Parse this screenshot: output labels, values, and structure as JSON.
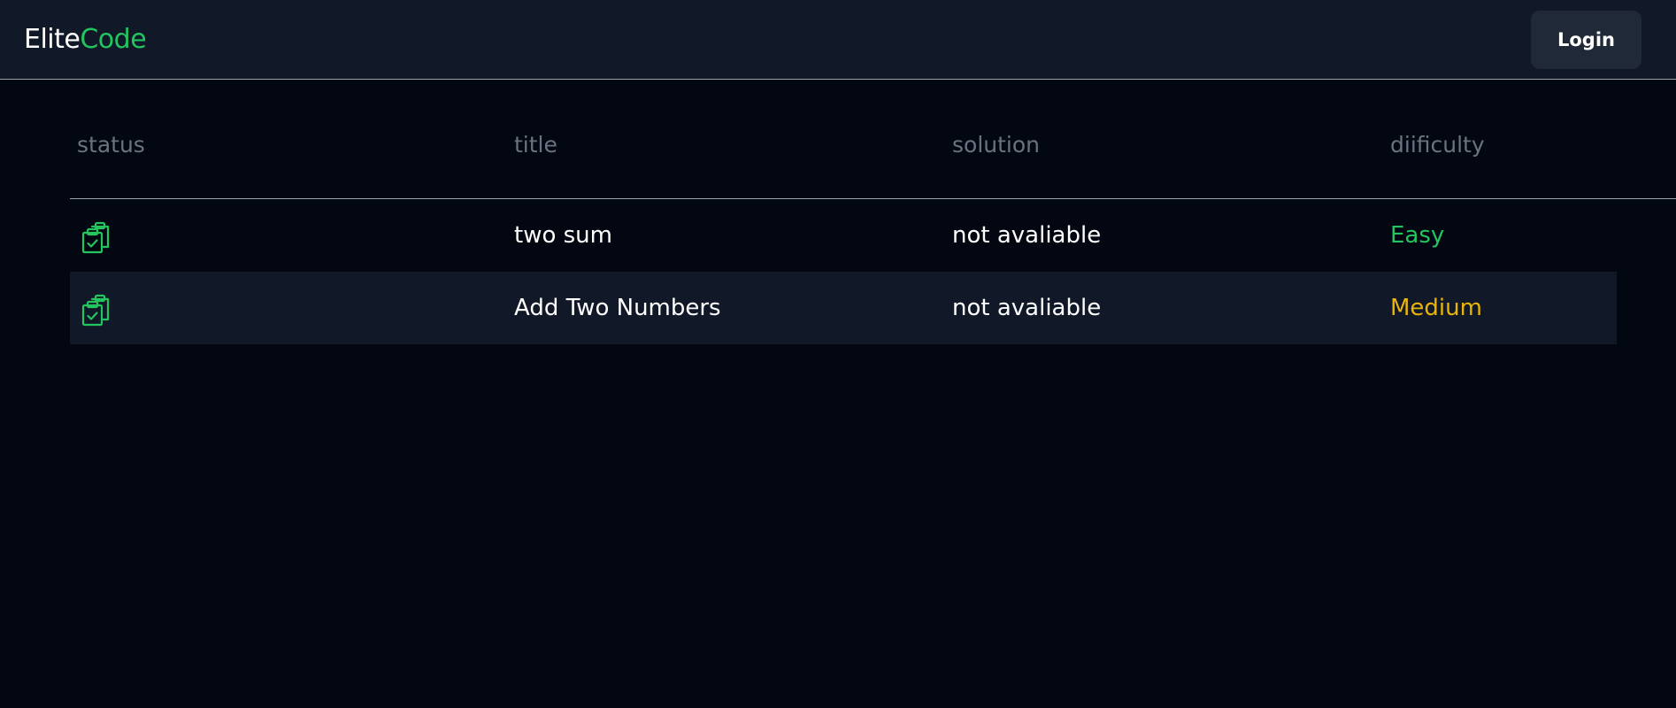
{
  "navbar": {
    "brand_part1": "Elite",
    "brand_part2": "Code",
    "login_label": "Login"
  },
  "colors": {
    "accent": "#22c55e",
    "easy": "#22c55e",
    "medium": "#eab308",
    "background": "#030712",
    "navbar_bg": "#111827"
  },
  "table": {
    "headers": [
      "status",
      "title",
      "solution",
      "diificulty"
    ],
    "rows": [
      {
        "status_icon": "clipboard-check-icon",
        "title": "two sum",
        "solution": "not avaliable",
        "difficulty": "Easy"
      },
      {
        "status_icon": "clipboard-check-icon",
        "title": "Add Two Numbers",
        "solution": "not avaliable",
        "difficulty": "Medium"
      }
    ]
  }
}
